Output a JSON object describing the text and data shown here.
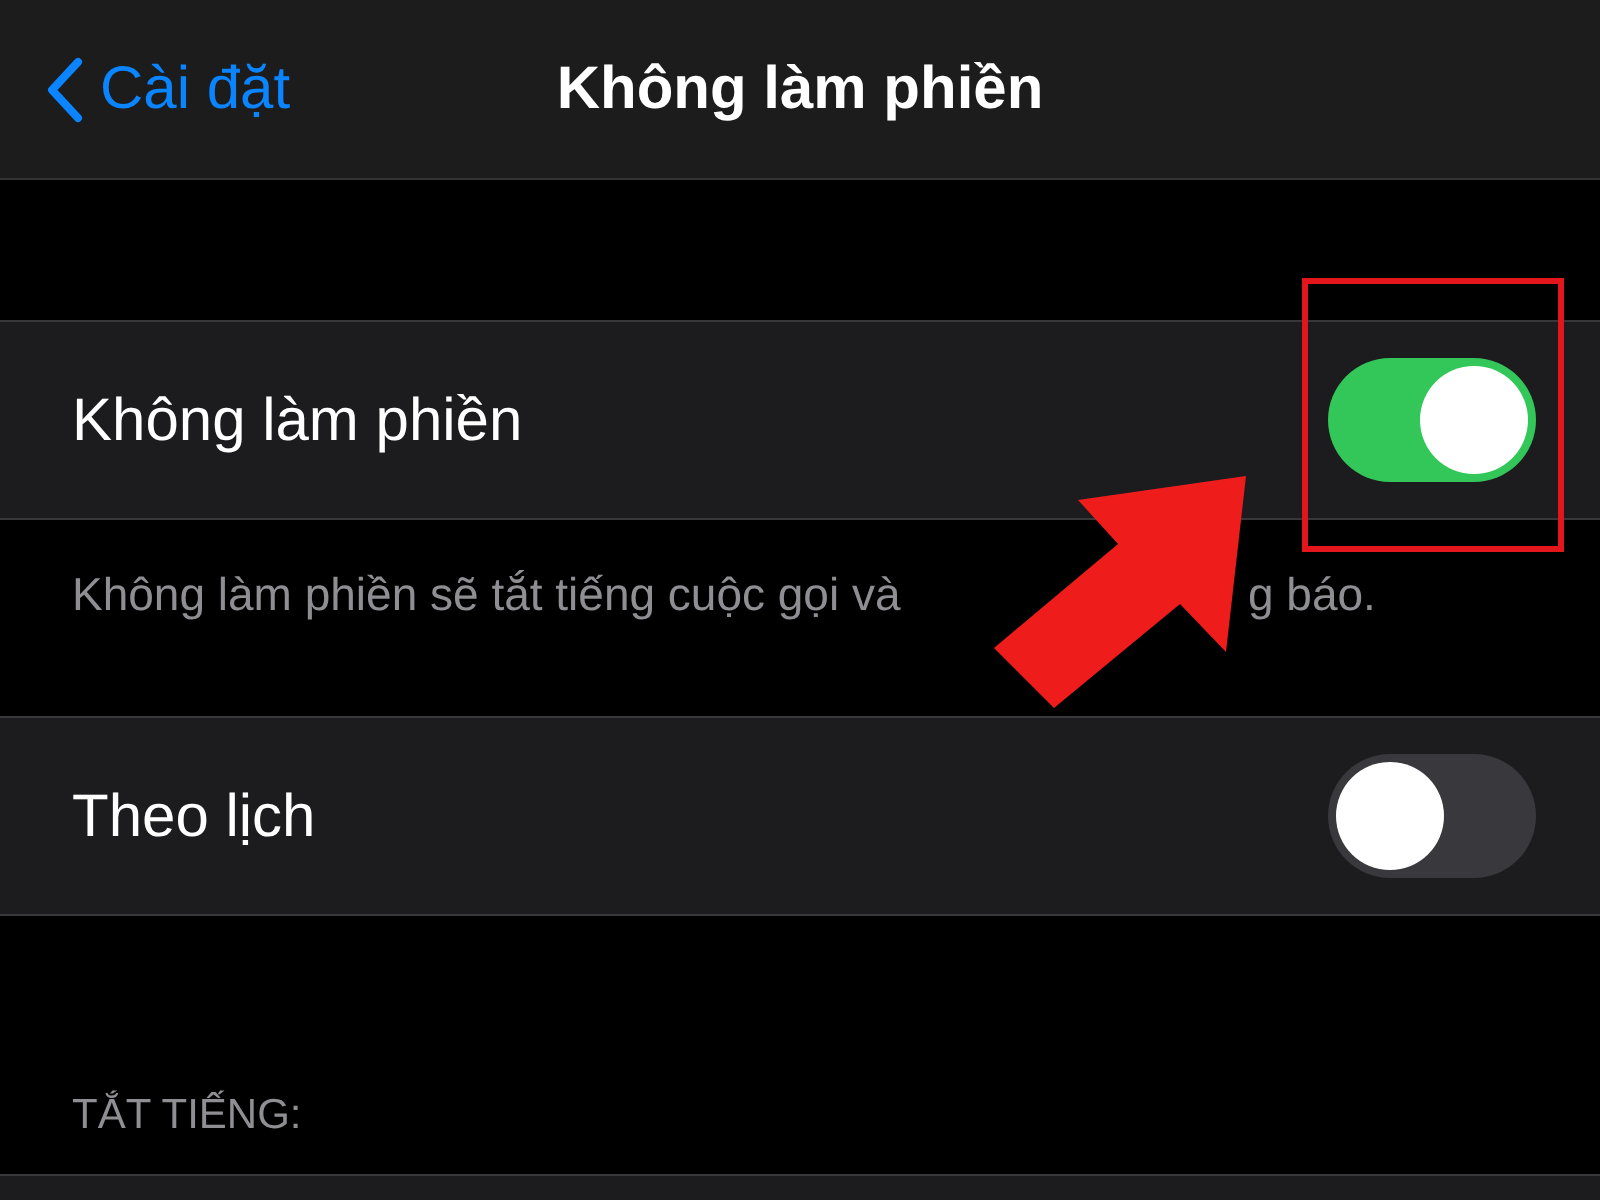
{
  "nav": {
    "back_label": "Cài đặt",
    "title": "Không làm phiền"
  },
  "rows": [
    {
      "label": "Không làm phiền",
      "on": true,
      "footer_visible_start": "Không làm phiền sẽ tắt tiếng cuộc gọi và",
      "footer_visible_end": "g báo."
    },
    {
      "label": "Theo lịch",
      "on": false
    }
  ],
  "section_header": "TẮT TIẾNG:"
}
